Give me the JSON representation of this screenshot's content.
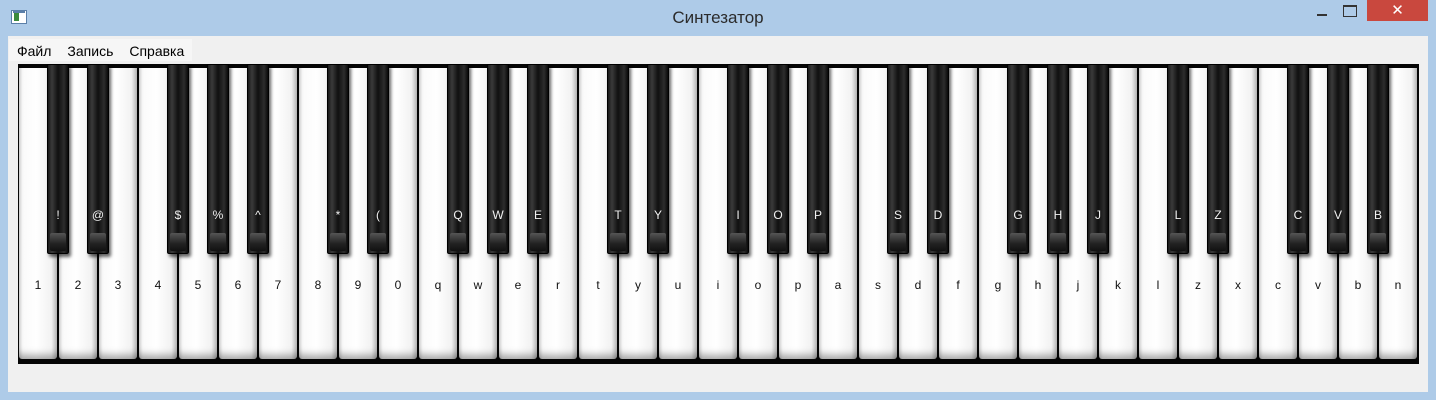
{
  "window": {
    "title": "Синтезатор",
    "close_glyph": "✕"
  },
  "menu": [
    "Файл",
    "Запись",
    "Справка"
  ],
  "keyboard": {
    "white_keys": [
      "1",
      "2",
      "3",
      "4",
      "5",
      "6",
      "7",
      "8",
      "9",
      "0",
      "q",
      "w",
      "e",
      "r",
      "t",
      "y",
      "u",
      "i",
      "o",
      "p",
      "a",
      "s",
      "d",
      "f",
      "g",
      "h",
      "j",
      "k",
      "l",
      "z",
      "x",
      "c",
      "v",
      "b",
      "n"
    ],
    "black_keys": [
      {
        "after_white": 0,
        "label": "!"
      },
      {
        "after_white": 1,
        "label": "@"
      },
      {
        "after_white": 3,
        "label": "$"
      },
      {
        "after_white": 4,
        "label": "%"
      },
      {
        "after_white": 5,
        "label": "^"
      },
      {
        "after_white": 7,
        "label": "*"
      },
      {
        "after_white": 8,
        "label": "("
      },
      {
        "after_white": 10,
        "label": "Q"
      },
      {
        "after_white": 11,
        "label": "W"
      },
      {
        "after_white": 12,
        "label": "E"
      },
      {
        "after_white": 14,
        "label": "T"
      },
      {
        "after_white": 15,
        "label": "Y"
      },
      {
        "after_white": 17,
        "label": "I"
      },
      {
        "after_white": 18,
        "label": "O"
      },
      {
        "after_white": 19,
        "label": "P"
      },
      {
        "after_white": 21,
        "label": "S"
      },
      {
        "after_white": 22,
        "label": "D"
      },
      {
        "after_white": 24,
        "label": "G"
      },
      {
        "after_white": 25,
        "label": "H"
      },
      {
        "after_white": 26,
        "label": "J"
      },
      {
        "after_white": 28,
        "label": "L"
      },
      {
        "after_white": 29,
        "label": "Z"
      },
      {
        "after_white": 31,
        "label": "C"
      },
      {
        "after_white": 32,
        "label": "V"
      },
      {
        "after_white": 33,
        "label": "B"
      }
    ]
  }
}
